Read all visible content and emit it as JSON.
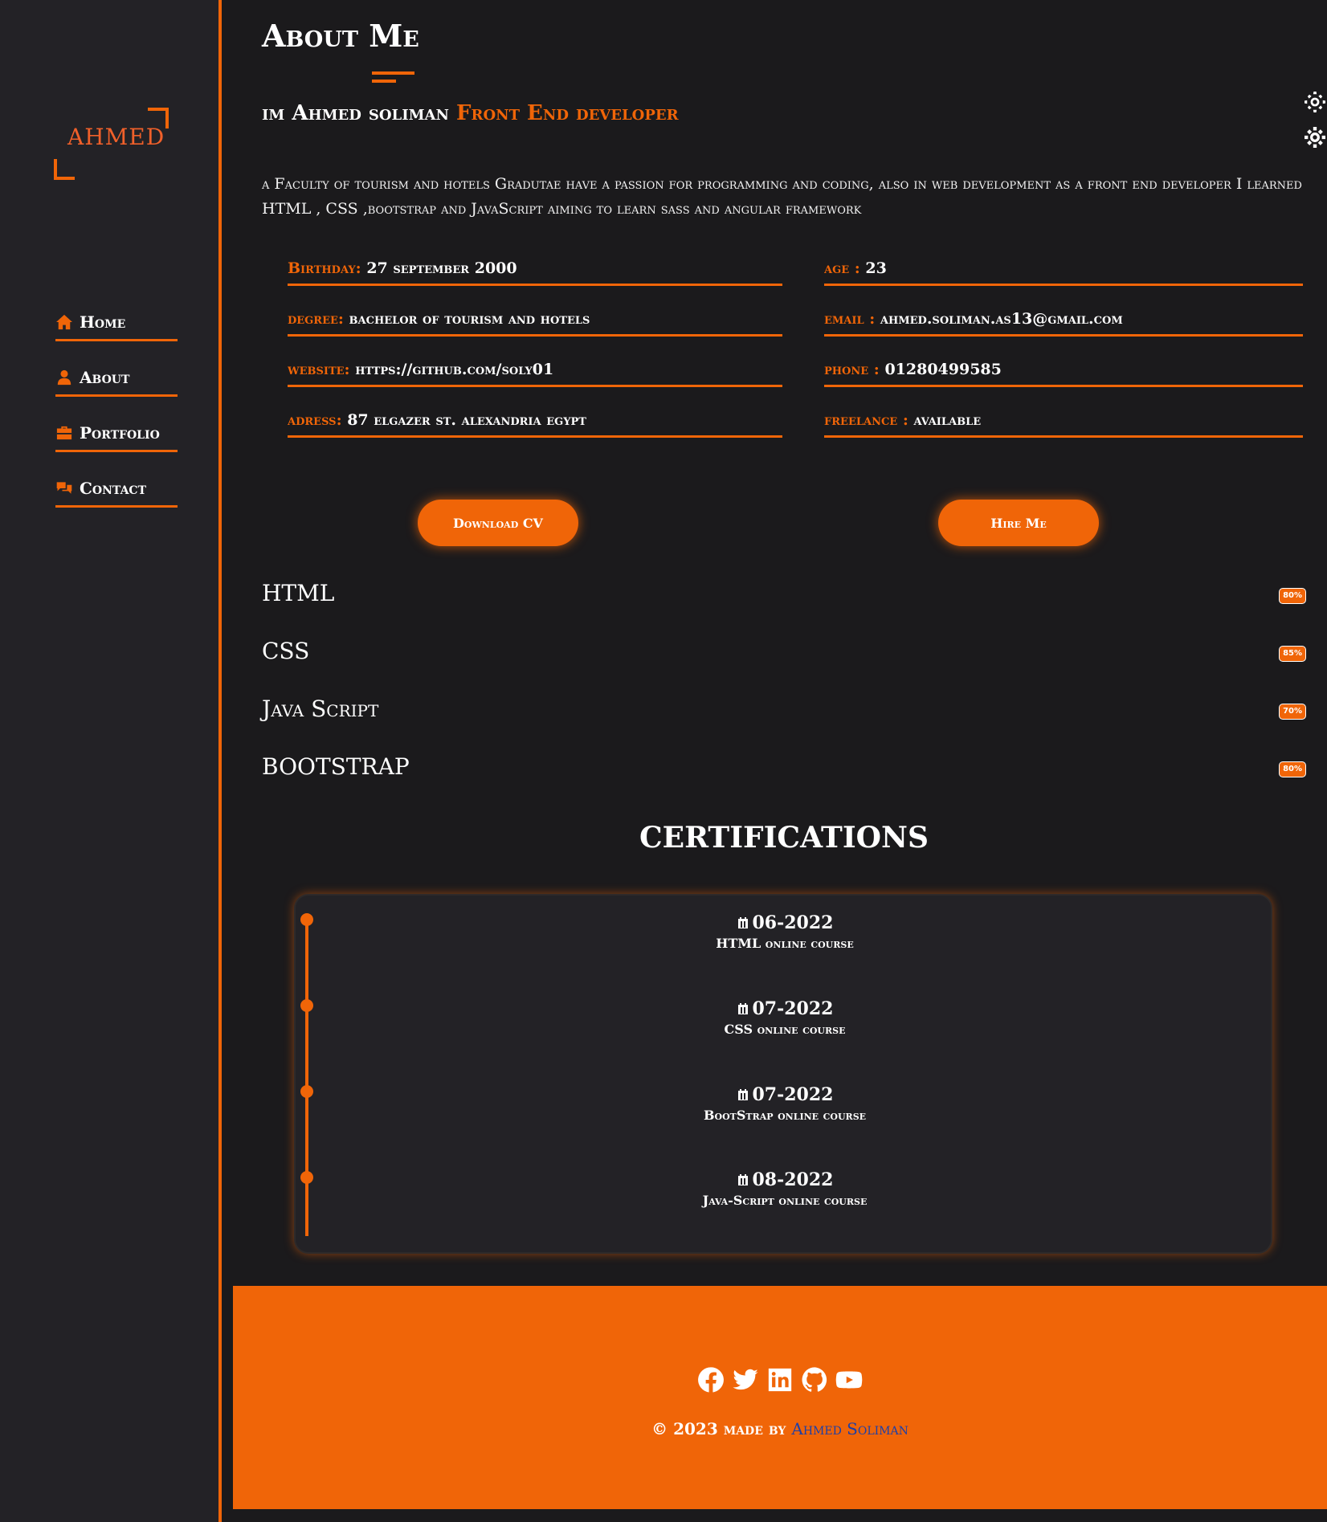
{
  "sidebar": {
    "logo": "AHMED",
    "nav": [
      {
        "label": "Home",
        "icon": "home-icon"
      },
      {
        "label": "About",
        "icon": "user-icon"
      },
      {
        "label": "Portfolio",
        "icon": "briefcase-icon"
      },
      {
        "label": "Contact",
        "icon": "comments-icon"
      }
    ]
  },
  "settings_icons": [
    "gear-icon",
    "cog-icon"
  ],
  "about": {
    "title": "About Me",
    "intro_name": "im Ahmed soliman",
    "intro_role": "Front End developer",
    "bio": "a Faculty of tourism and hotels Gradutae have a passion for programming and coding, also in web development as a front end developer I learned HTML , CSS ,bootstrap and JavaScript aiming to learn sass and angular framework",
    "info": [
      {
        "key": "Birthday:",
        "value": "27 september 2000"
      },
      {
        "key": "age :",
        "value": "23"
      },
      {
        "key": "degree:",
        "value": "bachelor of tourism and hotels"
      },
      {
        "key": "email :",
        "value": "ahmed.soliman.as13@gmail.com"
      },
      {
        "key": "website:",
        "value": "https://github.com/soly01"
      },
      {
        "key": "phone :",
        "value": "01280499585"
      },
      {
        "key": "adress:",
        "value": "87 elgazer st. alexandria egypt"
      },
      {
        "key": "freelance :",
        "value": "available"
      }
    ],
    "download_cv": "Download CV",
    "hire_me": "Hire Me"
  },
  "skills": [
    {
      "name": "HTML",
      "percent": "80%"
    },
    {
      "name": "CSS",
      "percent": "85%"
    },
    {
      "name": "Java Script",
      "percent": "70%"
    },
    {
      "name": "BOOTSTRAP",
      "percent": "80%"
    }
  ],
  "certifications": {
    "title": "CERTIFICATIONS",
    "items": [
      {
        "date": "06-2022",
        "course": "HTML online course"
      },
      {
        "date": "07-2022",
        "course": "CSS online course"
      },
      {
        "date": "07-2022",
        "course": "BootStrap online course"
      },
      {
        "date": "08-2022",
        "course": "Java-Script online course"
      }
    ]
  },
  "footer": {
    "social": [
      "facebook-icon",
      "twitter-icon",
      "linkedin-icon",
      "github-icon",
      "youtube-icon"
    ],
    "copyright_prefix": "© 2023 made by",
    "author": "Ahmed Soliman"
  },
  "colors": {
    "accent": "#f06508",
    "background": "#1b1a1c",
    "sidebar": "#232226"
  }
}
